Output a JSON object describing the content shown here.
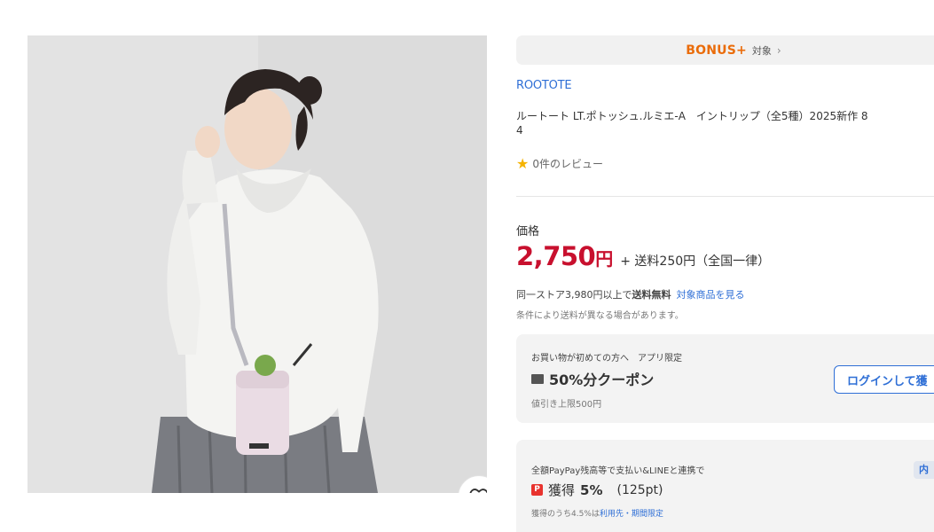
{
  "product": {
    "favorite_icon": "heart-outline-icon"
  },
  "bonus": {
    "label": "BONUS+",
    "tag": "対象",
    "chevron": "›"
  },
  "brand": "ROOTOTE",
  "title": "ルートート LT.ポトッシュ.ルミエ-A　イントリップ（全5種）2025新作 8\n4",
  "rating": {
    "star_icon": "star-icon",
    "text": "0件のレビュー"
  },
  "price": {
    "label": "価格",
    "amount": "2,750",
    "unit": "円",
    "shipping": "+ 送料250円（全国一律）"
  },
  "free_shipping": {
    "prefix": "同一ストア3,980円以上で",
    "bold": "送料無料",
    "link": "対象商品を見る",
    "note": "条件により送料が異なる場合があります。"
  },
  "coupon": {
    "meta": "お買い物が初めての方へ　アプリ限定",
    "title": "50%分クーポン",
    "sub": "値引き上限500円",
    "button": "ログインして獲"
  },
  "paypay": {
    "meta": "全額PayPay残高等で支払い&LINEと連携で",
    "icon": "P",
    "title_prefix": "獲得",
    "percent": "5%",
    "points": "(125pt)",
    "sub_prefix": "獲得のうち4.5%は",
    "sub_link": "利用先・期間限定",
    "tag": "内"
  },
  "colors": {
    "accent_blue": "#2f6fd6",
    "price_red": "#c8102e",
    "bonus_orange": "#ea6c0a",
    "paypay_red": "#e8332e"
  }
}
